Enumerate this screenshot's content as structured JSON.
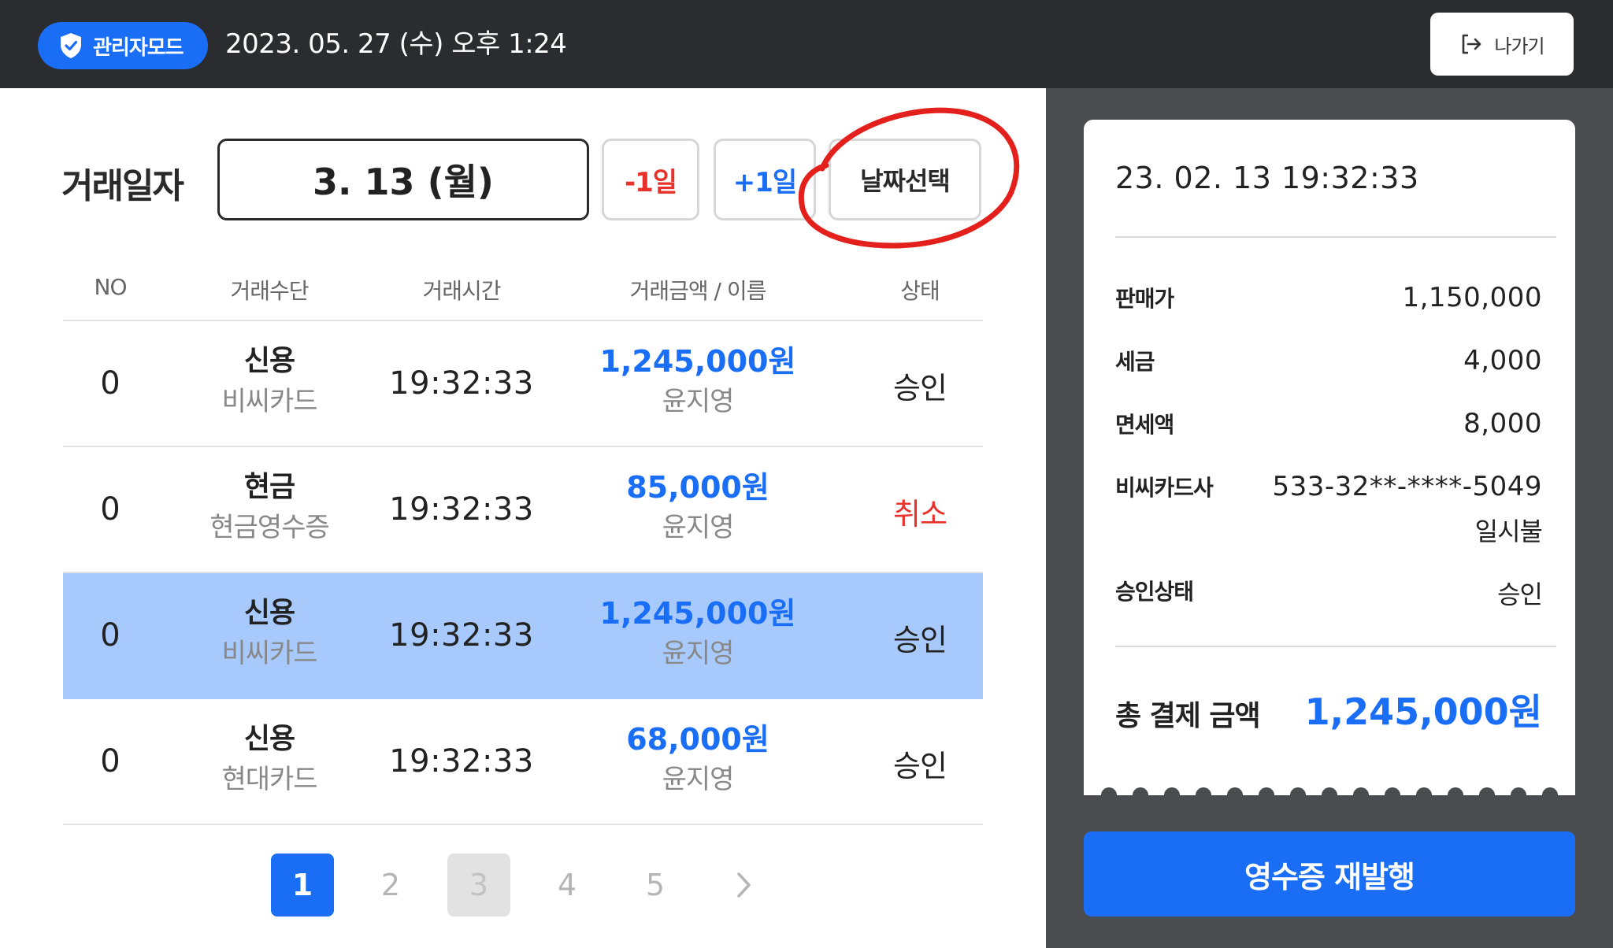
{
  "header": {
    "admin_badge": "관리자모드",
    "datetime": "2023. 05. 27 (수) 오후 1:24",
    "exit_label": "나가기",
    "icons": {
      "admin": "shield-check-icon",
      "exit": "logout-icon"
    }
  },
  "filter": {
    "label": "거래일자",
    "selected_date": "3. 13 (월)",
    "prev_day": "-1일",
    "next_day": "+1일",
    "pick_date": "날짜선택"
  },
  "table": {
    "columns": [
      "NO",
      "거래수단",
      "거래시간",
      "거래금액 / 이름",
      "상태"
    ],
    "rows": [
      {
        "no": "0",
        "method": "신용",
        "method_detail": "비씨카드",
        "time": "19:32:33",
        "amount": "1,245,000원",
        "name": "윤지영",
        "status": "승인",
        "status_type": "approved",
        "selected": false
      },
      {
        "no": "0",
        "method": "현금",
        "method_detail": "현금영수증",
        "time": "19:32:33",
        "amount": "85,000원",
        "name": "윤지영",
        "status": "취소",
        "status_type": "cancelled",
        "selected": false
      },
      {
        "no": "0",
        "method": "신용",
        "method_detail": "비씨카드",
        "time": "19:32:33",
        "amount": "1,245,000원",
        "name": "윤지영",
        "status": "승인",
        "status_type": "approved",
        "selected": true
      },
      {
        "no": "0",
        "method": "신용",
        "method_detail": "현대카드",
        "time": "19:32:33",
        "amount": "68,000원",
        "name": "윤지영",
        "status": "승인",
        "status_type": "approved",
        "selected": false
      }
    ]
  },
  "pagination": {
    "pages": [
      "1",
      "2",
      "3",
      "4",
      "5"
    ],
    "current": "1",
    "disabled": "3",
    "next_icon": "chevron-right-icon"
  },
  "receipt": {
    "datetime": "23. 02. 13  19:32:33",
    "sale_price_label": "판매가",
    "sale_price": "1,150,000",
    "tax_label": "세금",
    "tax": "4,000",
    "tax_free_label": "면세액",
    "tax_free": "8,000",
    "card_label": "비씨카드사",
    "card_number": "533-32**-****-5049",
    "installment": "일시불",
    "approval_label": "승인상태",
    "approval": "승인",
    "total_label": "총 결제 금액",
    "total": "1,245,000원"
  },
  "reissue_label": "영수증 재발행",
  "colors": {
    "accent": "#1a6ef5",
    "danger": "#e8312b",
    "topbar": "#2b2c2f",
    "panel": "#4b4c50",
    "selected_row": "#a7c9fc"
  }
}
